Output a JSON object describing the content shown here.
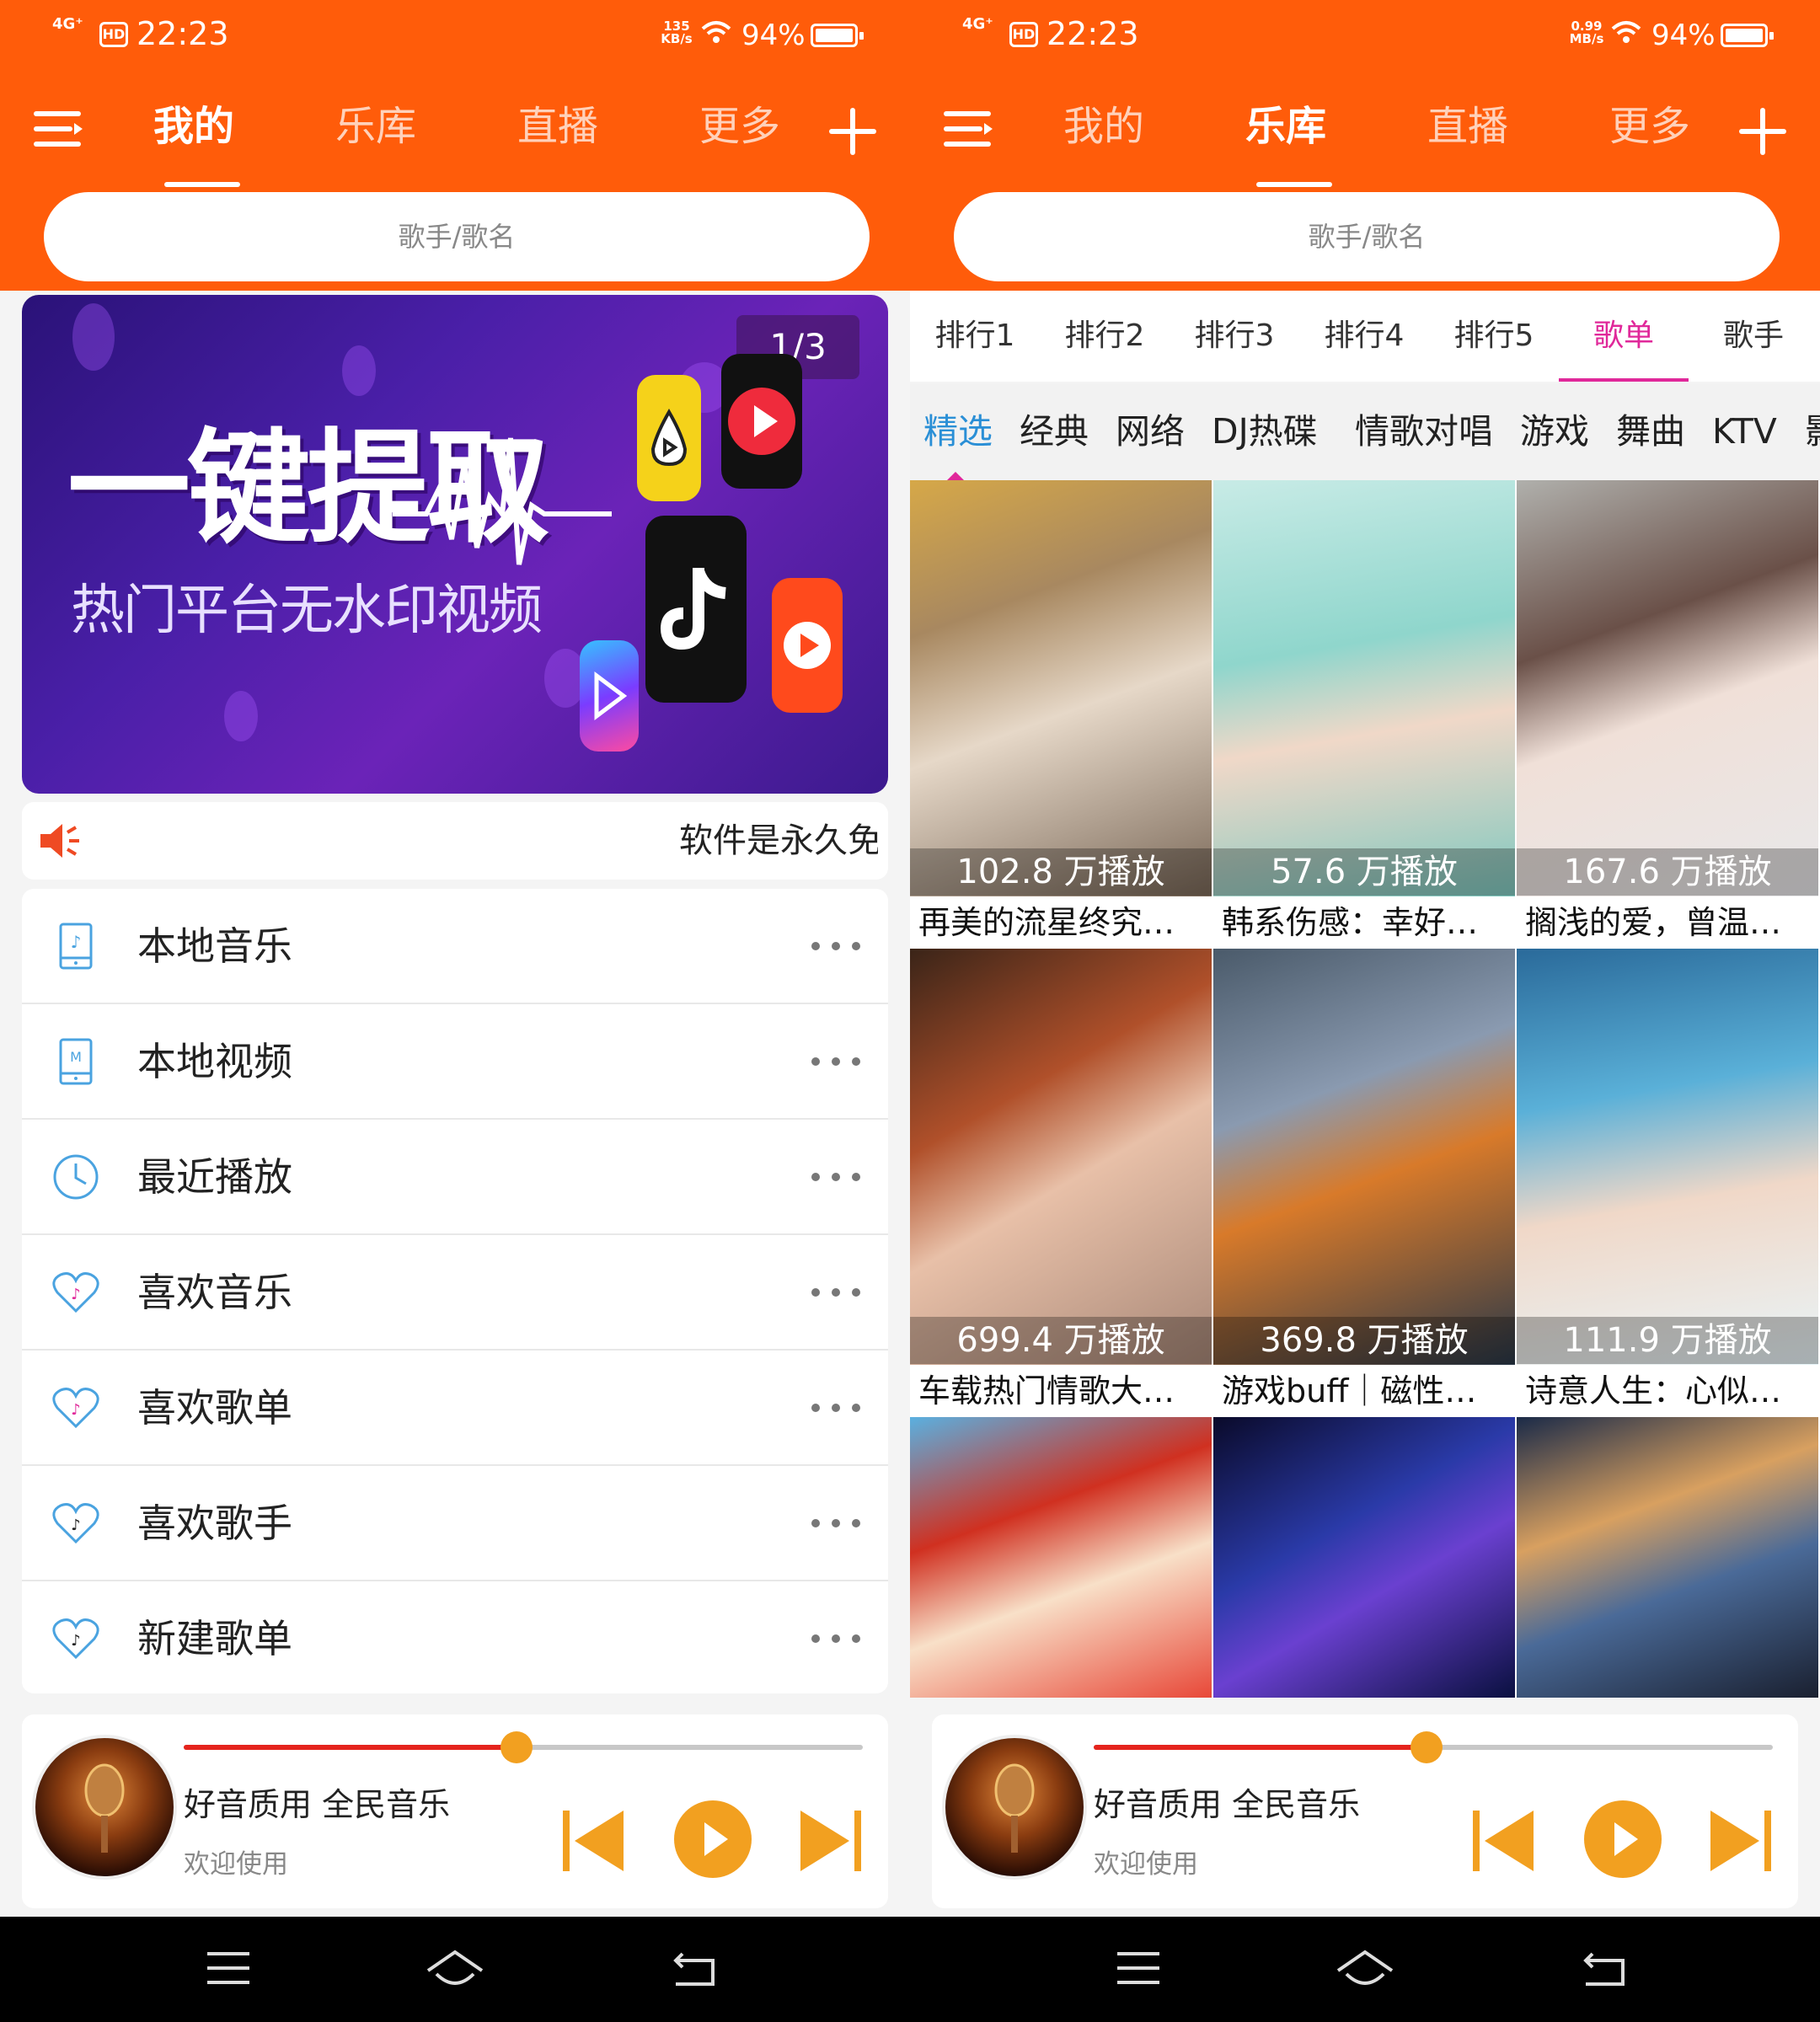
{
  "status_left": {
    "network": "4G⁺",
    "hd": "HD",
    "time": "22:23",
    "speed": "135 KB/s",
    "battery": "94%"
  },
  "status_right": {
    "network": "4G⁺",
    "hd": "HD",
    "time": "22:23",
    "speed": "0.99 MB/s",
    "battery": "94%"
  },
  "nav": {
    "tabs": [
      "我的",
      "乐库",
      "直播",
      "更多"
    ]
  },
  "search": {
    "placeholder": "歌手/歌名"
  },
  "banner": {
    "title": "一键提取",
    "subtitle": "热门平台无水印视频",
    "counter": "1/3"
  },
  "notice": {
    "text": "软件是永久免"
  },
  "menu": {
    "items": [
      {
        "label": "本地音乐",
        "icon": "music-file-icon"
      },
      {
        "label": "本地视频",
        "icon": "video-file-icon"
      },
      {
        "label": "最近播放",
        "icon": "clock-icon"
      },
      {
        "label": "喜欢音乐",
        "icon": "heart-music-icon"
      },
      {
        "label": "喜欢歌单",
        "icon": "heart-music-icon"
      },
      {
        "label": "喜欢歌手",
        "icon": "heart-music-icon"
      },
      {
        "label": "新建歌单",
        "icon": "heart-music-icon"
      }
    ]
  },
  "player": {
    "title": "好音质用  全民音乐",
    "subtitle": "欢迎使用",
    "progress": 0.49
  },
  "category_tabs": [
    "排行1",
    "排行2",
    "排行3",
    "排行4",
    "排行5",
    "歌单",
    "歌手"
  ],
  "sub_tabs": [
    "精选",
    "经典",
    "网络",
    "DJ热碟",
    "情歌对唱",
    "游戏",
    "舞曲",
    "KTV",
    "影"
  ],
  "playlists": [
    {
      "plays": "102.8  万播放",
      "name": "再美的流星终究…"
    },
    {
      "plays": "57.6  万播放",
      "name": "韩系伤感：幸好…"
    },
    {
      "plays": "167.6  万播放",
      "name": "搁浅的爱，曾温…"
    },
    {
      "plays": "699.4  万播放",
      "name": "车载热门情歌大…"
    },
    {
      "plays": "369.8  万播放",
      "name": "游戏buff｜磁性…"
    },
    {
      "plays": "111.9  万播放",
      "name": "诗意人生：心似…"
    },
    {
      "plays": "",
      "name": ""
    },
    {
      "plays": "",
      "name": ""
    },
    {
      "plays": "",
      "name": ""
    }
  ],
  "colors": {
    "brand": "#ff5c0a",
    "accent_pink": "#e0289a",
    "accent_blue": "#2a8fd6",
    "progress_red": "#e5241d",
    "control_orange": "#f2a020"
  }
}
